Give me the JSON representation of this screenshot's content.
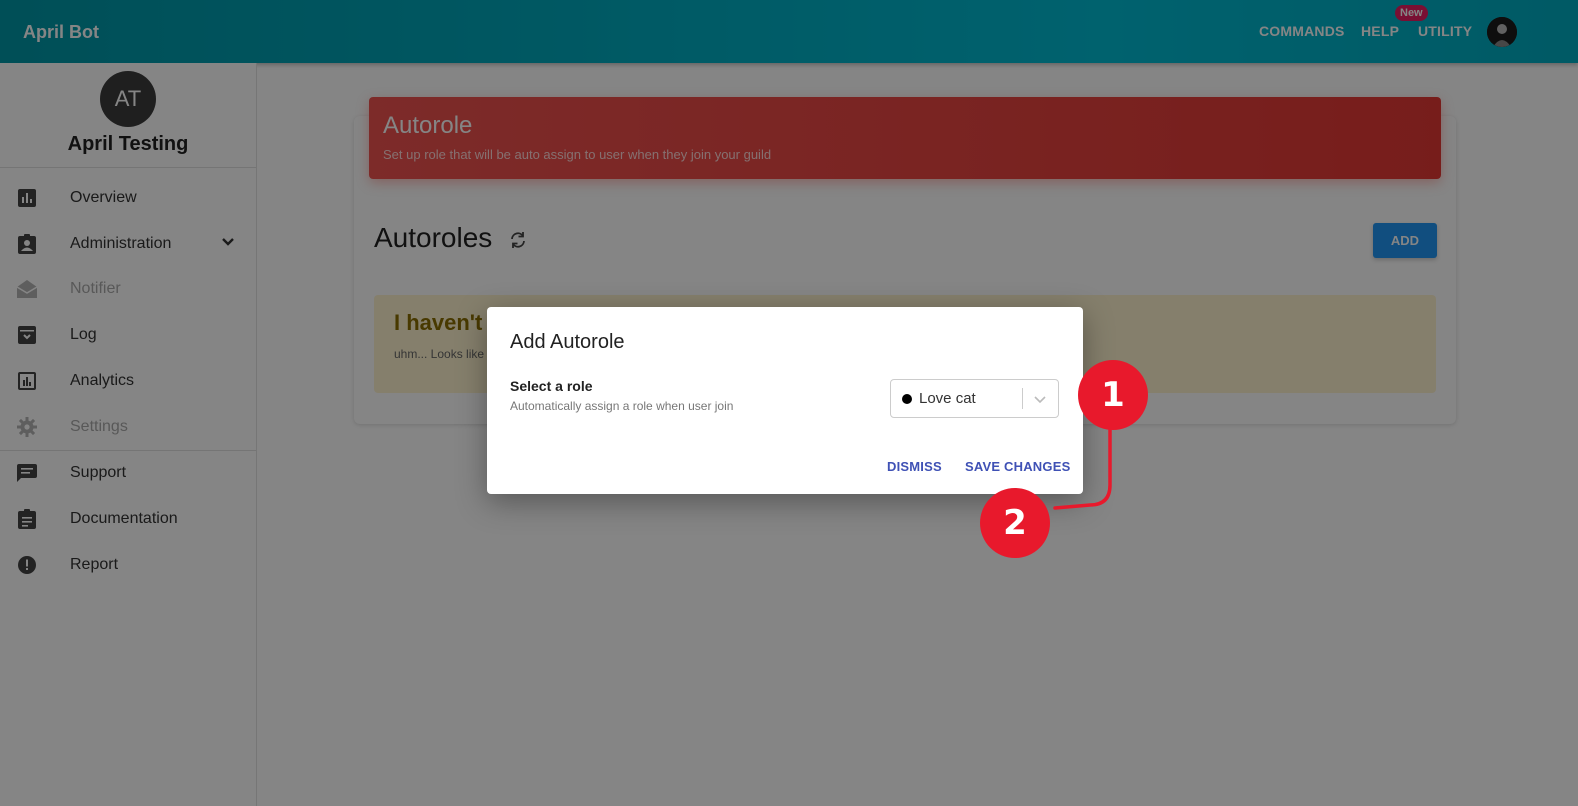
{
  "app": {
    "brand": "April Bot"
  },
  "topnav": {
    "commands": "COMMANDS",
    "help": "HELP",
    "utility": "UTILITY",
    "new_badge": "New"
  },
  "guild": {
    "initials": "AT",
    "name": "April Testing"
  },
  "sidebar": {
    "items": [
      {
        "label": "Overview",
        "icon": "bar-chart-icon"
      },
      {
        "label": "Administration",
        "icon": "badge-icon"
      },
      {
        "label": "Notifier",
        "icon": "mail-open-icon"
      },
      {
        "label": "Log",
        "icon": "archive-icon"
      },
      {
        "label": "Analytics",
        "icon": "analytics-icon"
      },
      {
        "label": "Settings",
        "icon": "gear-icon"
      },
      {
        "label": "Support",
        "icon": "chat-icon"
      },
      {
        "label": "Documentation",
        "icon": "clipboard-icon"
      },
      {
        "label": "Report",
        "icon": "alert-icon"
      }
    ]
  },
  "page": {
    "header_title": "Autorole",
    "header_subtitle": "Set up role that will be auto assign to user when they join your guild",
    "section_title": "Autoroles",
    "add_label": "ADD",
    "alert_title": "I haven't",
    "alert_text": "uhm... Looks like"
  },
  "dialog": {
    "title": "Add Autorole",
    "field_label": "Select a role",
    "field_help": "Automatically assign a role when user join",
    "selected_role": "Love cat",
    "dismiss": "DISMISS",
    "save": "SAVE CHANGES"
  },
  "annotations": {
    "step1": "1",
    "step2": "2"
  },
  "colors": {
    "topbar": "#00acc1",
    "header": "#e53935",
    "primary": "#3f51b5",
    "marker": "#e8192c"
  }
}
